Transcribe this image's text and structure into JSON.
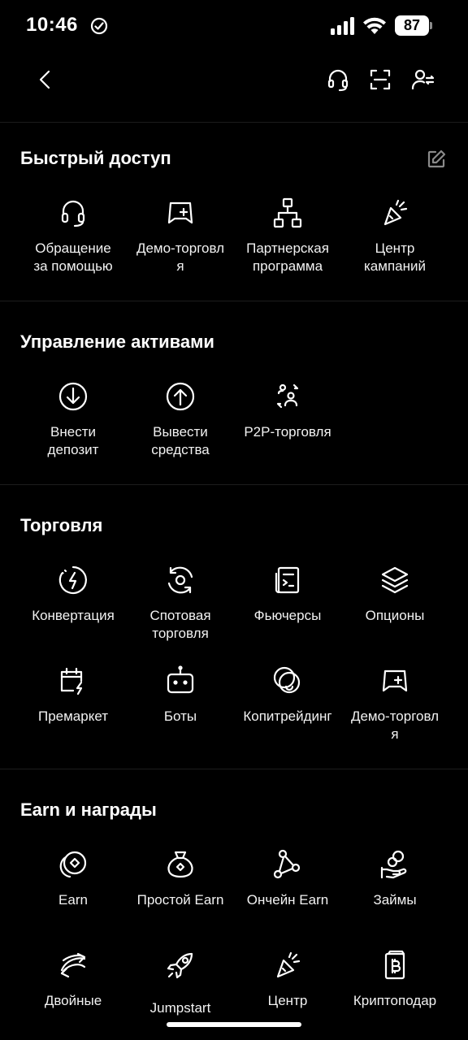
{
  "status_bar": {
    "time": "10:46",
    "battery": "87"
  },
  "sections": {
    "quick": {
      "title": "Быстрый доступ",
      "items": [
        {
          "label": "Обращение\nза помощью",
          "icon": "headset-icon"
        },
        {
          "label": "Демо-торговл\nя",
          "icon": "gamepad-icon"
        },
        {
          "label": "Партнерская\nпрограмма",
          "icon": "network-icon"
        },
        {
          "label": "Центр\nкампаний",
          "icon": "party-popper-icon"
        }
      ]
    },
    "assets": {
      "title": "Управление активами",
      "items": [
        {
          "label": "Внести\nдепозит",
          "icon": "deposit-icon"
        },
        {
          "label": "Вывести\nсредства",
          "icon": "withdraw-icon"
        },
        {
          "label": "P2P-торговля",
          "icon": "p2p-icon"
        }
      ]
    },
    "trading": {
      "title": "Торговля",
      "items": [
        {
          "label": "Конвертация",
          "icon": "convert-icon"
        },
        {
          "label": "Спотовая\nторговля",
          "icon": "spot-icon"
        },
        {
          "label": "Фьючерсы",
          "icon": "futures-icon"
        },
        {
          "label": "Опционы",
          "icon": "layers-icon"
        },
        {
          "label": "Премаркет",
          "icon": "premarket-icon"
        },
        {
          "label": "Боты",
          "icon": "bot-icon"
        },
        {
          "label": "Копитрейдинг",
          "icon": "copytrading-icon"
        },
        {
          "label": "Демо-торговл\nя",
          "icon": "gamepad-icon"
        }
      ]
    },
    "earn": {
      "title": "Earn и награды",
      "items": [
        {
          "label": "Earn",
          "icon": "coins-icon"
        },
        {
          "label": "Простой Earn",
          "icon": "money-bag-icon"
        },
        {
          "label": "Ончейн Earn",
          "icon": "onchain-icon"
        },
        {
          "label": "Займы",
          "icon": "loan-icon"
        },
        {
          "label": "Двойные",
          "icon": "dual-icon"
        },
        {
          "label": "Jumpstart",
          "icon": "rocket-icon"
        },
        {
          "label": "Центр",
          "icon": "party-popper-icon"
        },
        {
          "label": "Криптоподар",
          "icon": "gift-card-icon"
        }
      ]
    }
  }
}
